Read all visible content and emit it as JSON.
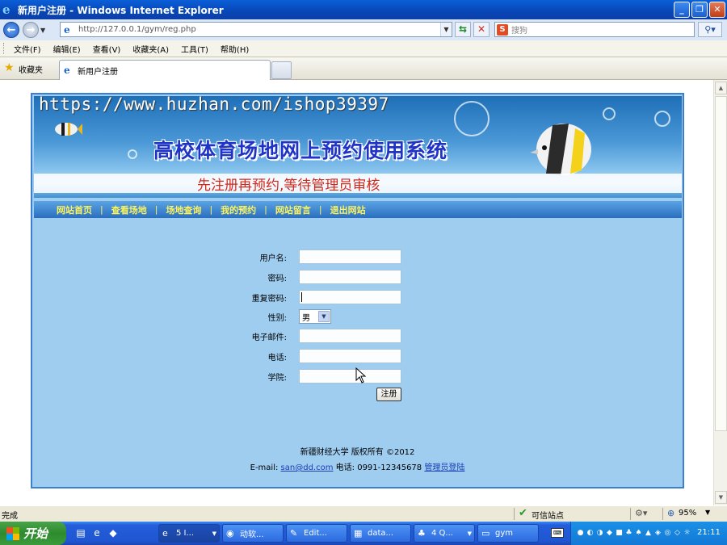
{
  "window": {
    "title": "新用户注册 - Windows Internet Explorer"
  },
  "address_bar": {
    "url": "http://127.0.0.1/gym/reg.php",
    "search_placeholder": "搜狗"
  },
  "menu": [
    "文件(F)",
    "编辑(E)",
    "查看(V)",
    "收藏夹(A)",
    "工具(T)",
    "帮助(H)"
  ],
  "favorites_label": "收藏夹",
  "tab": {
    "label": "新用户注册"
  },
  "site": {
    "watermark": "https://www.huzhan.com/ishop39397",
    "title": "高校体育场地网上预约使用系统",
    "notice": "先注册再预约,等待管理员审核",
    "nav": [
      "网站首页",
      "查看场地",
      "场地查询",
      "我的预约",
      "网站留言",
      "退出网站"
    ]
  },
  "form": {
    "fields": [
      {
        "label": "用户名:",
        "value": ""
      },
      {
        "label": "密码:",
        "value": ""
      },
      {
        "label": "重复密码:",
        "value": ""
      },
      {
        "label": "性别:",
        "value": "男"
      },
      {
        "label": "电子邮件:",
        "value": ""
      },
      {
        "label": "电话:",
        "value": ""
      },
      {
        "label": "学院:",
        "value": ""
      }
    ],
    "submit_label": "注册"
  },
  "footer": {
    "copyright": "新疆财经大学 版权所有 ©2012",
    "email_label": "E-mail:",
    "email": "san@dd.com",
    "phone": "电话: 0991-12345678",
    "admin_link": "管理员登陆"
  },
  "status_bar": {
    "status": "完成",
    "zone": "可信站点",
    "zoom": "95%"
  },
  "taskbar": {
    "start_label": "开始",
    "buttons": [
      {
        "label": "5 I...",
        "icon": "ie-icon"
      },
      {
        "label": "动软...",
        "icon": "app-icon"
      },
      {
        "label": "Edit...",
        "icon": "edit-icon"
      },
      {
        "label": "data...",
        "icon": "db-icon"
      },
      {
        "label": "4 Q...",
        "icon": "qq-icon"
      },
      {
        "label": "gym",
        "icon": "folder-icon"
      }
    ],
    "clock": "21:11"
  }
}
